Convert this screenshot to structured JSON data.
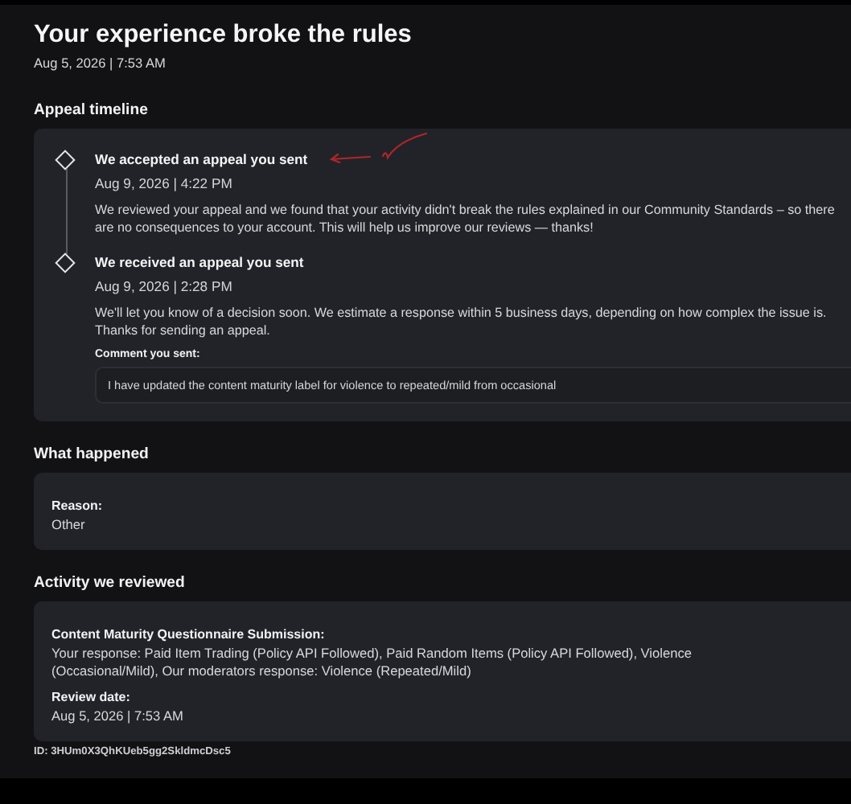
{
  "header": {
    "title": "Your experience broke the rules",
    "date": "Aug 5, 2026 | 7:53 AM"
  },
  "appeal_timeline": {
    "heading": "Appeal timeline",
    "events": [
      {
        "title": "We accepted an appeal you sent",
        "date": "Aug 9, 2026 | 4:22 PM",
        "body": "We reviewed your appeal and we found that your activity didn't break the rules explained in our Community Standards – so there are no consequences to your account. This will help us improve our reviews — thanks!"
      },
      {
        "title": "We received an appeal you sent",
        "date": "Aug 9, 2026 | 2:28 PM",
        "body": "We'll let you know of a decision soon. We estimate a response within 5 business days, depending on how complex the issue is. Thanks for sending an appeal.",
        "comment_label": "Comment you sent:",
        "comment": "I have updated the content maturity label for violence to repeated/mild from occasional"
      }
    ]
  },
  "what_happened": {
    "heading": "What happened",
    "fields": [
      {
        "label": "Reason:",
        "value": "Other"
      }
    ]
  },
  "activity": {
    "heading": "Activity we reviewed",
    "fields": [
      {
        "label": "Content Maturity Questionnaire Submission:",
        "value": "Your response: Paid Item Trading (Policy API Followed), Paid Random Items (Policy API Followed), Violence (Occasional/Mild), Our moderators response: Violence (Repeated/Mild)"
      },
      {
        "label": "Review date:",
        "value": "Aug 5, 2026 | 7:53 AM"
      }
    ]
  },
  "id": "ID: 3HUm0X3QhKUeb5gg2SkldmcDsc5"
}
